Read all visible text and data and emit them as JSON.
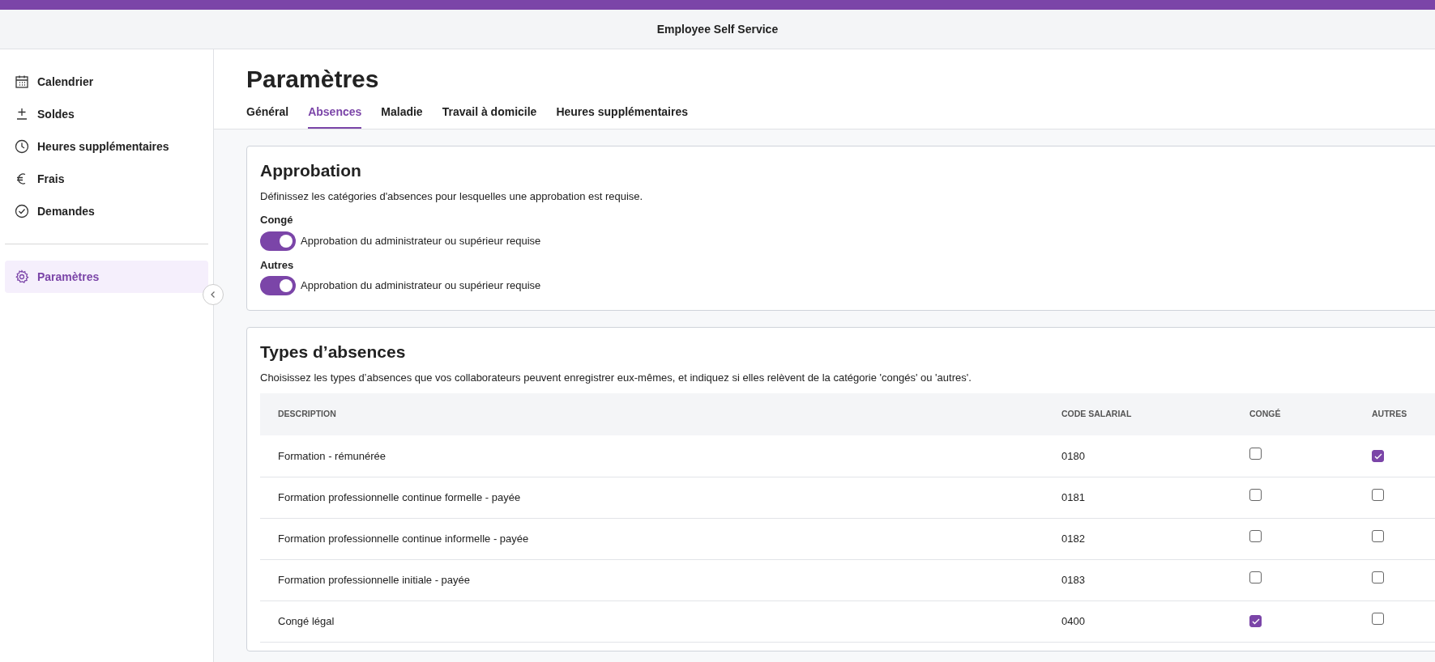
{
  "header": {
    "title": "Employee Self Service"
  },
  "sidebar": {
    "items": [
      {
        "label": "Calendrier",
        "kind": "calendar",
        "selected": false
      },
      {
        "label": "Soldes",
        "kind": "plusminus",
        "selected": false
      },
      {
        "label": "Heures supplémentaires",
        "kind": "clock",
        "selected": false
      },
      {
        "label": "Frais",
        "kind": "euro",
        "selected": false
      },
      {
        "label": "Demandes",
        "kind": "check",
        "selected": false
      }
    ],
    "bottom_items": [
      {
        "label": "Paramètres",
        "kind": "gear",
        "selected": true
      }
    ]
  },
  "page": {
    "title": "Paramètres",
    "tabs": [
      {
        "label": "Général",
        "selected": false
      },
      {
        "label": "Absences",
        "selected": true
      },
      {
        "label": "Maladie",
        "selected": false
      },
      {
        "label": "Travail à domicile",
        "selected": false
      },
      {
        "label": "Heures supplémentaires",
        "selected": false
      }
    ]
  },
  "approval": {
    "title": "Approbation",
    "description": "Définissez les catégories d'absences pour lesquelles une approbation est requise.",
    "settings": [
      {
        "label": "Congé",
        "toggle_label": "Approbation du administrateur ou supérieur requise",
        "on": true
      },
      {
        "label": "Autres",
        "toggle_label": "Approbation du administrateur ou supérieur requise",
        "on": true
      }
    ]
  },
  "absence_types": {
    "title": "Types d’absences",
    "description": "Choisissez les types d’absences que vos collaborateurs peuvent enregistrer eux-mêmes, et indiquez si elles relèvent de la catégorie 'congés' ou 'autres'.",
    "table": {
      "columns": [
        "DESCRIPTION",
        "CODE SALARIAL",
        "CONGÉ",
        "AUTRES"
      ],
      "rows": [
        {
          "description": "Formation - rémunérée",
          "code": "0180",
          "conge": false,
          "autres": true
        },
        {
          "description": "Formation professionnelle continue formelle - payée",
          "code": "0181",
          "conge": false,
          "autres": false
        },
        {
          "description": "Formation professionnelle continue informelle - payée",
          "code": "0182",
          "conge": false,
          "autres": false
        },
        {
          "description": "Formation professionnelle initiale - payée",
          "code": "0183",
          "conge": false,
          "autres": false
        },
        {
          "description": "Congé légal",
          "code": "0400",
          "conge": true,
          "autres": false
        }
      ]
    }
  }
}
